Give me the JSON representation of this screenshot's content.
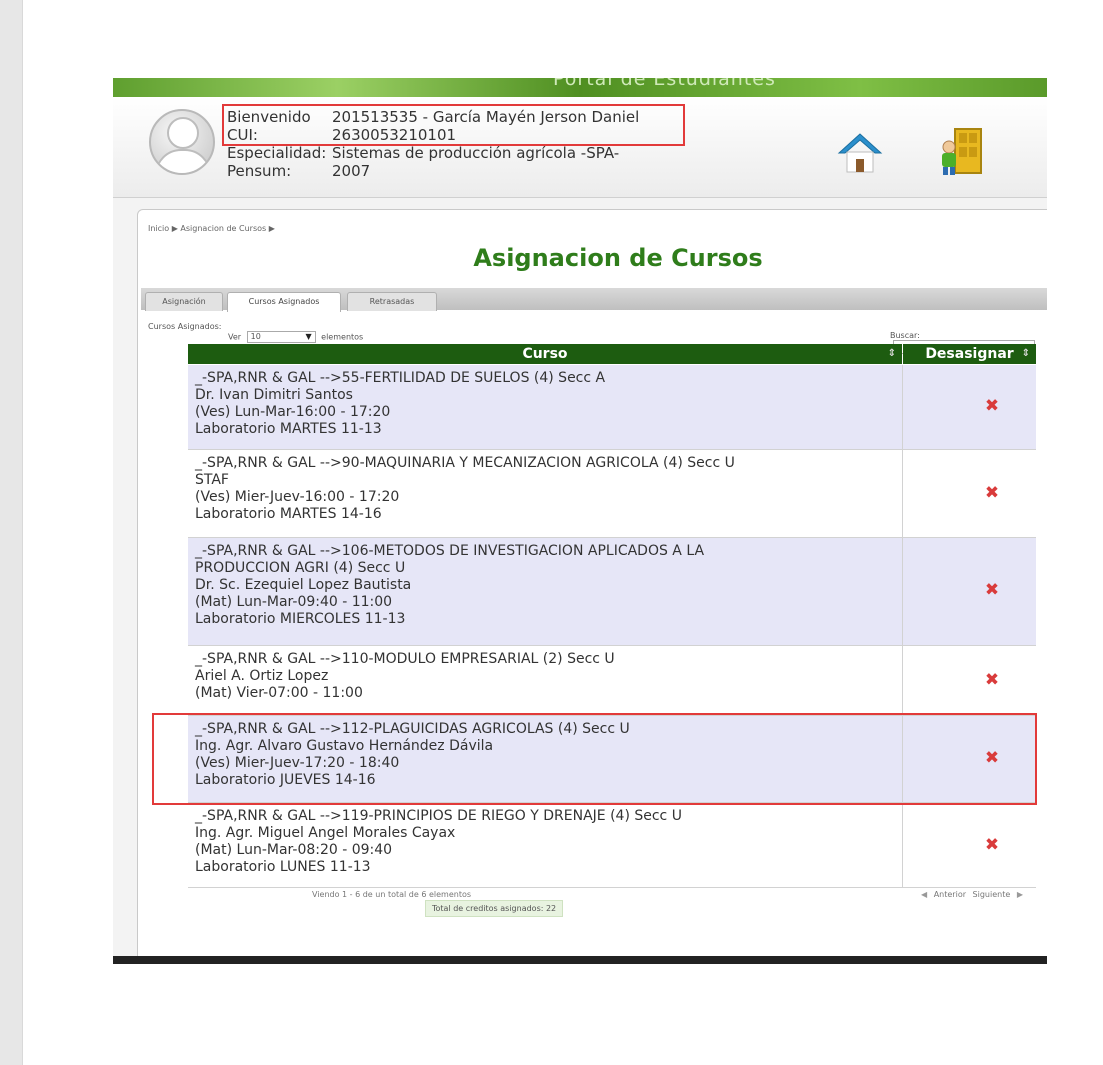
{
  "header": {
    "banner_title": "Portal de Estudiantes",
    "user": {
      "bienvenido_label": "Bienvenido",
      "bienvenido_value": "201513535 - García Mayén Jerson Daniel",
      "cui_label": "CUI:",
      "cui_value": "2630053210101",
      "especialidad_label": "Especialidad:",
      "especialidad_value": "Sistemas de producción agrícola -SPA-",
      "pensum_label": "Pensum:",
      "pensum_value": "2007"
    },
    "icons": [
      "home-icon",
      "exit-door-icon"
    ]
  },
  "breadcrumb": "Inicio ▶ Asignacion de Cursos ▶",
  "page_title": "Asignacion de Cursos",
  "tabs": [
    {
      "label": "Asignación"
    },
    {
      "label": "Cursos Asignados",
      "active": true
    },
    {
      "label": "Retrasadas"
    }
  ],
  "table": {
    "caption": "Cursos Asignados:",
    "show_prefix": "Ver",
    "show_value": "10",
    "show_suffix": "elementos",
    "search_label": "Buscar:",
    "search_value": "",
    "columns": [
      "Curso",
      "Desasignar"
    ],
    "rows": [
      {
        "lines": [
          "_-SPA,RNR & GAL -->55-FERTILIDAD DE SUELOS (4) Secc A",
          "Dr. Ivan Dimitri Santos",
          "(Ves) Lun-Mar-16:00 - 17:20",
          "Laboratorio MARTES 11-13"
        ],
        "action": "✖"
      },
      {
        "lines": [
          "_-SPA,RNR & GAL -->90-MAQUINARIA Y MECANIZACION AGRICOLA (4) Secc U",
          "STAF",
          "(Ves) Mier-Juev-16:00 - 17:20",
          "Laboratorio MARTES 14-16"
        ],
        "action": "✖"
      },
      {
        "lines": [
          "_-SPA,RNR & GAL -->106-METODOS DE INVESTIGACION APLICADOS A LA",
          "PRODUCCION AGRI (4) Secc U",
          "Dr. Sc. Ezequiel Lopez Bautista",
          "(Mat) Lun-Mar-09:40 - 11:00",
          "Laboratorio MIERCOLES 11-13"
        ],
        "action": "✖"
      },
      {
        "lines": [
          "_-SPA,RNR & GAL -->110-MODULO EMPRESARIAL (2) Secc U",
          "Ariel A. Ortiz Lopez",
          "(Mat) Vier-07:00 - 11:00"
        ],
        "action": "✖"
      },
      {
        "lines": [
          "_-SPA,RNR & GAL -->112-PLAGUICIDAS AGRICOLAS (4) Secc U",
          "Ing. Agr. Alvaro Gustavo Hernández Dávila",
          "(Ves) Mier-Juev-17:20 - 18:40",
          "Laboratorio JUEVES 14-16"
        ],
        "action": "✖"
      },
      {
        "lines": [
          "_-SPA,RNR & GAL -->119-PRINCIPIOS DE RIEGO Y DRENAJE (4) Secc U",
          "Ing. Agr. Miguel Angel Morales Cayax",
          "(Mat) Lun-Mar-08:20 - 09:40",
          "Laboratorio LUNES 11-13"
        ],
        "action": "✖"
      }
    ],
    "footer": "Viendo 1 - 6 de un total de 6 elementos",
    "total": "Total de creditos asignados: 22",
    "prev": "Anterior",
    "next": "Siguiente"
  },
  "colors": {
    "header_green": "#1d5c10",
    "title_green": "#2f7d1b",
    "row_alt": "#e6e6f7",
    "delete_red": "#d93b3b",
    "highlight_red": "#e23a3a"
  }
}
